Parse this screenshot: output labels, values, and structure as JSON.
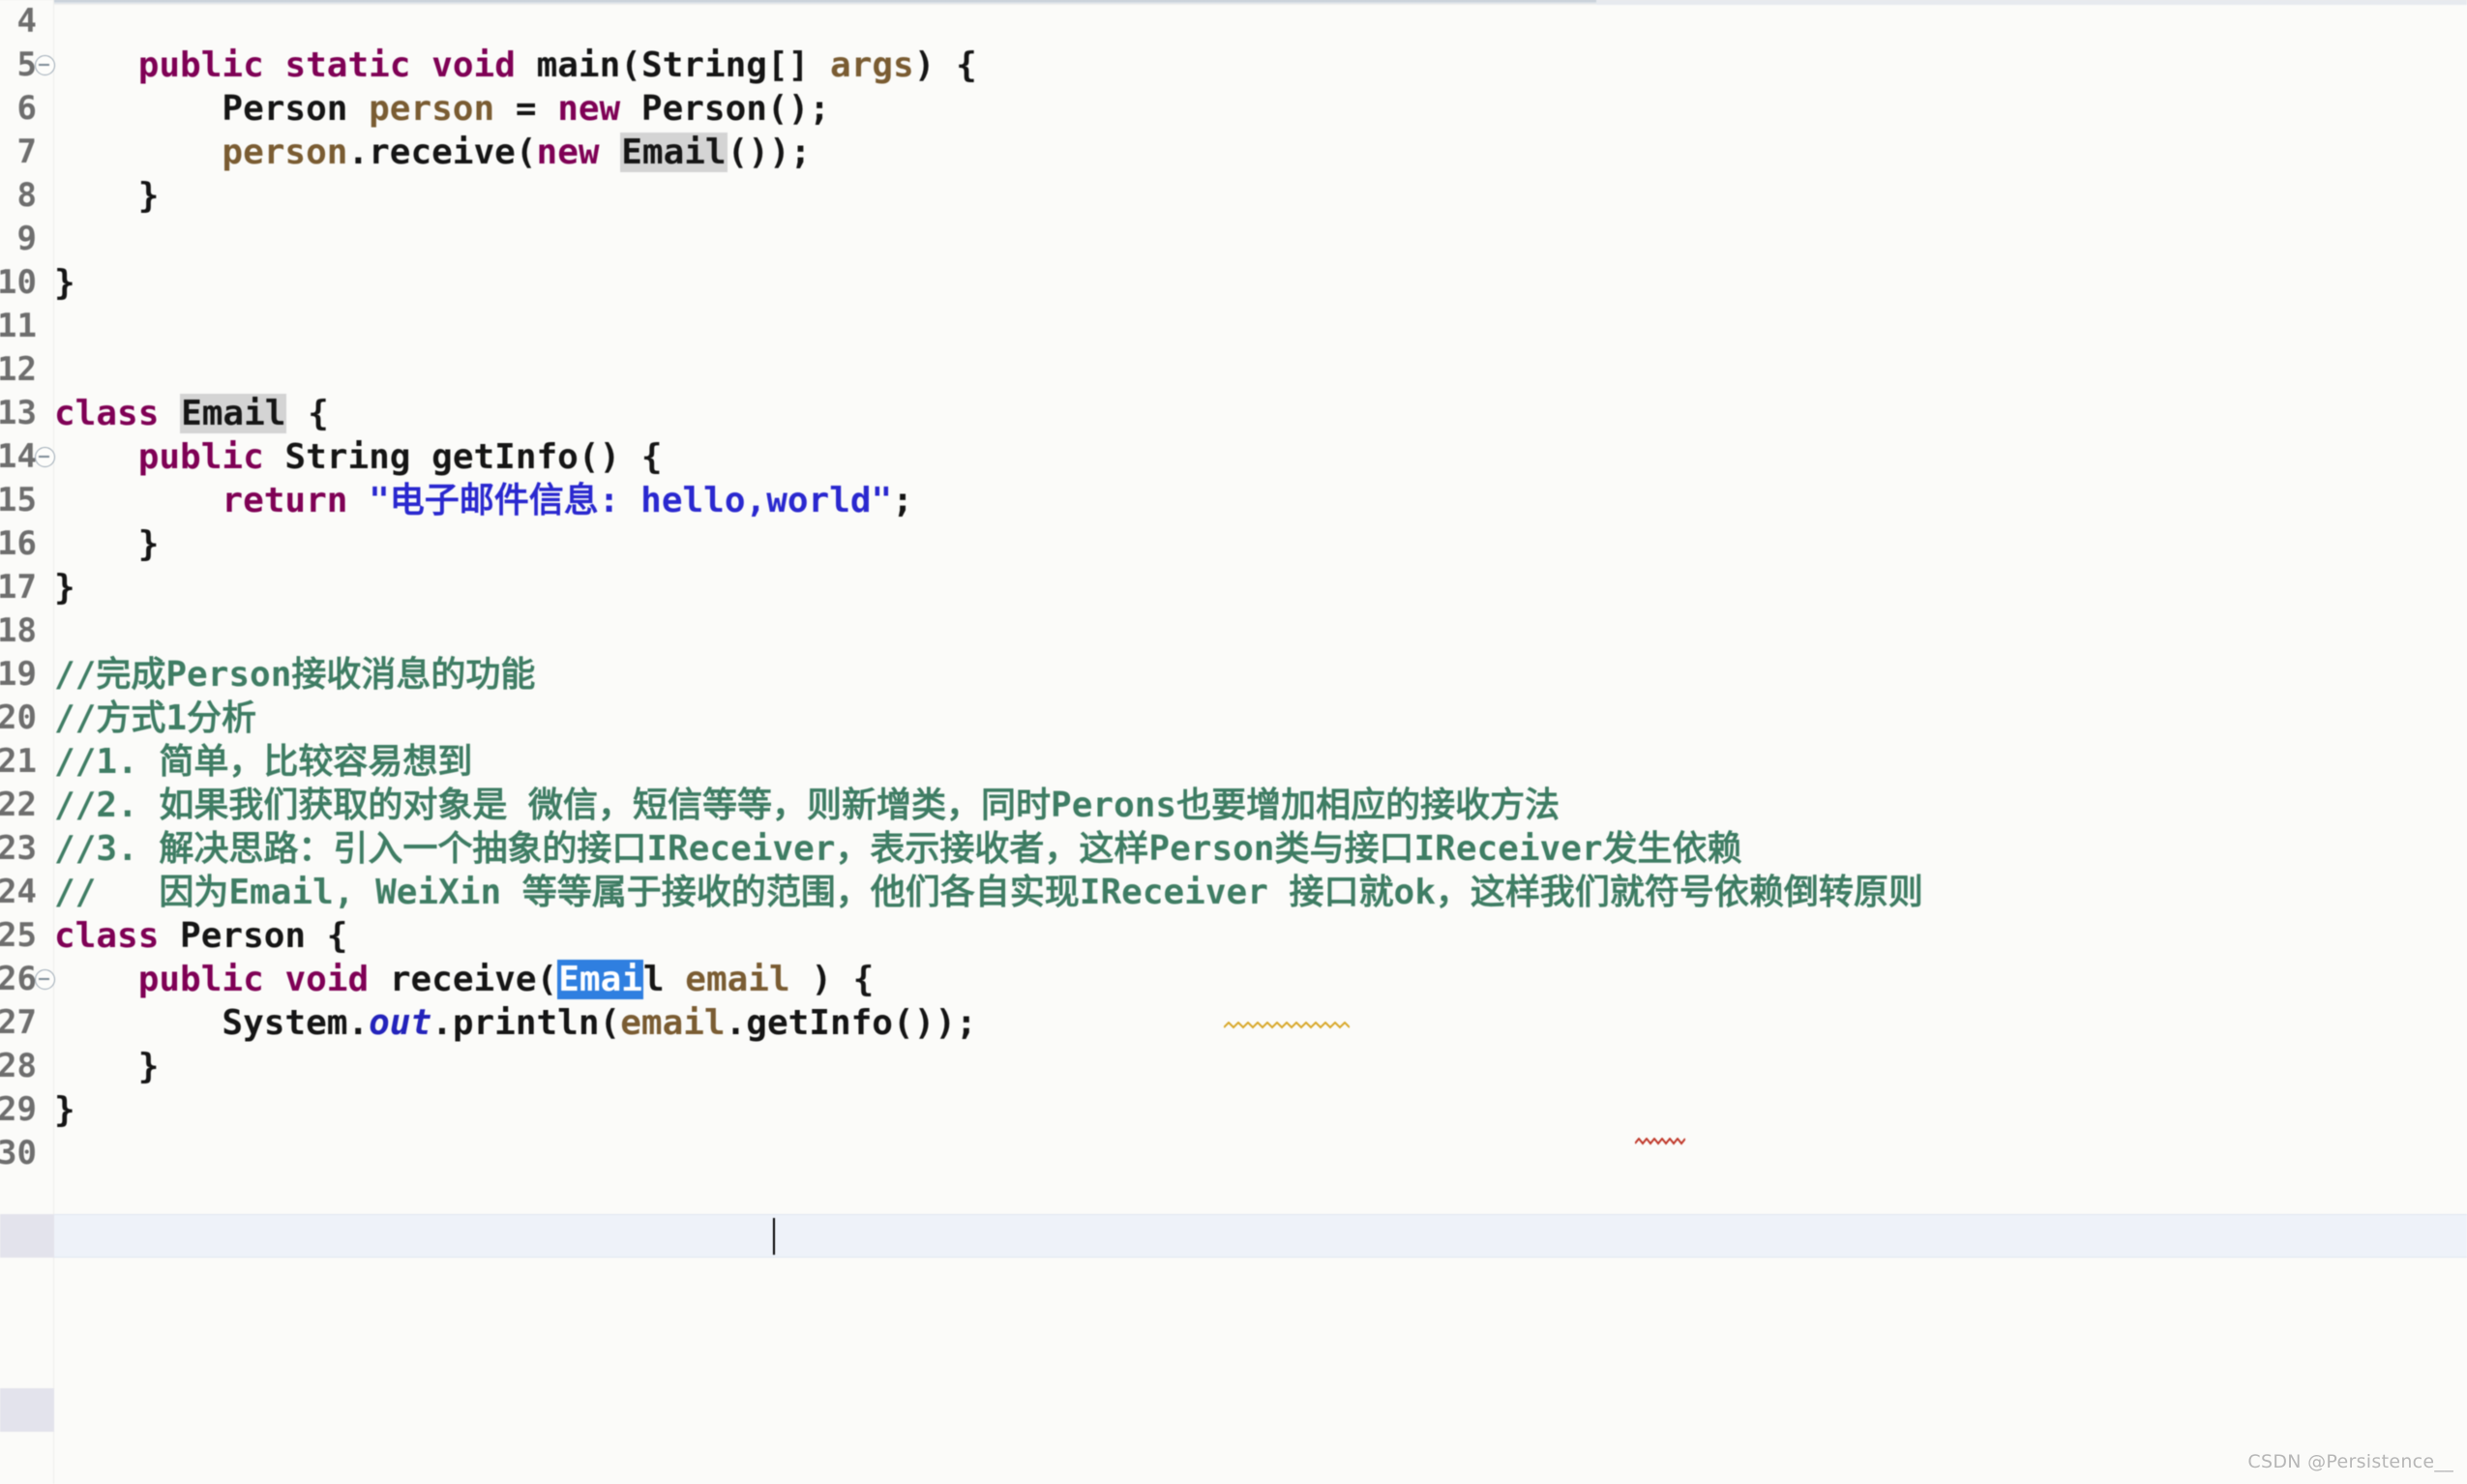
{
  "editor": {
    "language": "java",
    "watermark": "CSDN @Persistence__",
    "colors": {
      "background": "#fbfbf9",
      "keyword": "#7f0055",
      "string": "#2a28cf",
      "comment": "#3f7d64",
      "plain": "#151515",
      "local_variable": "#7a5c32",
      "static_field": "#2323bb",
      "occurrence_highlight": "#d4d4d4",
      "selection": "#2f7fe0",
      "current_line": "#eef2f9",
      "line_number": "#6e6e6e"
    },
    "selection_text": "Emai",
    "current_line_number": "26"
  },
  "lines": [
    {
      "number": "4",
      "fold": false,
      "current": false,
      "tokens": [
        {
          "t": "",
          "c": "plain"
        }
      ]
    },
    {
      "number": "5",
      "fold": true,
      "current": false,
      "tokens": [
        {
          "t": "    ",
          "c": "plain"
        },
        {
          "t": "public",
          "c": "kw"
        },
        {
          "t": " ",
          "c": "plain"
        },
        {
          "t": "static",
          "c": "kw"
        },
        {
          "t": " ",
          "c": "plain"
        },
        {
          "t": "void",
          "c": "kw"
        },
        {
          "t": " ",
          "c": "plain"
        },
        {
          "t": "main",
          "c": "plain"
        },
        {
          "t": "(String[] ",
          "c": "plain"
        },
        {
          "t": "args",
          "c": "fld"
        },
        {
          "t": ") {",
          "c": "plain"
        }
      ]
    },
    {
      "number": "6",
      "fold": false,
      "current": false,
      "tokens": [
        {
          "t": "        Person ",
          "c": "plain"
        },
        {
          "t": "person",
          "c": "fld"
        },
        {
          "t": " = ",
          "c": "plain"
        },
        {
          "t": "new",
          "c": "kw"
        },
        {
          "t": " Person();",
          "c": "plain"
        }
      ]
    },
    {
      "number": "7",
      "fold": false,
      "current": false,
      "tokens": [
        {
          "t": "        ",
          "c": "plain"
        },
        {
          "t": "person",
          "c": "fld"
        },
        {
          "t": ".receive(",
          "c": "plain"
        },
        {
          "t": "new",
          "c": "kw"
        },
        {
          "t": " ",
          "c": "plain"
        },
        {
          "t": "Email",
          "c": "plain occ"
        },
        {
          "t": "());",
          "c": "plain"
        }
      ]
    },
    {
      "number": "8",
      "fold": false,
      "current": false,
      "tokens": [
        {
          "t": "    }",
          "c": "plain"
        }
      ]
    },
    {
      "number": "9",
      "fold": false,
      "current": false,
      "tokens": [
        {
          "t": "",
          "c": "plain"
        }
      ]
    },
    {
      "number": "10",
      "fold": false,
      "current": false,
      "tokens": [
        {
          "t": "}",
          "c": "plain"
        }
      ]
    },
    {
      "number": "11",
      "fold": false,
      "current": false,
      "tokens": [
        {
          "t": "",
          "c": "plain"
        }
      ]
    },
    {
      "number": "12",
      "fold": false,
      "current": false,
      "tokens": [
        {
          "t": "",
          "c": "plain"
        }
      ]
    },
    {
      "number": "13",
      "fold": false,
      "current": false,
      "tokens": [
        {
          "t": "class",
          "c": "kw"
        },
        {
          "t": " ",
          "c": "plain"
        },
        {
          "t": "Email",
          "c": "plain occ"
        },
        {
          "t": " {",
          "c": "plain"
        }
      ]
    },
    {
      "number": "14",
      "fold": true,
      "current": false,
      "tokens": [
        {
          "t": "    ",
          "c": "plain"
        },
        {
          "t": "public",
          "c": "kw"
        },
        {
          "t": " String getInfo() {",
          "c": "plain"
        }
      ]
    },
    {
      "number": "15",
      "fold": false,
      "current": false,
      "tokens": [
        {
          "t": "        ",
          "c": "plain"
        },
        {
          "t": "return",
          "c": "kw"
        },
        {
          "t": " ",
          "c": "plain"
        },
        {
          "t": "\"电子邮件信息: hello,world\"",
          "c": "str"
        },
        {
          "t": ";",
          "c": "plain"
        }
      ]
    },
    {
      "number": "16",
      "fold": false,
      "current": false,
      "tokens": [
        {
          "t": "    }",
          "c": "plain"
        }
      ]
    },
    {
      "number": "17",
      "fold": false,
      "current": false,
      "tokens": [
        {
          "t": "}",
          "c": "plain"
        }
      ]
    },
    {
      "number": "18",
      "fold": false,
      "current": false,
      "tokens": [
        {
          "t": "",
          "c": "plain"
        }
      ]
    },
    {
      "number": "19",
      "fold": false,
      "current": false,
      "tokens": [
        {
          "t": "//完成Person接收消息的功能",
          "c": "cmt"
        }
      ]
    },
    {
      "number": "20",
      "fold": false,
      "current": false,
      "tokens": [
        {
          "t": "//方式1分析",
          "c": "cmt"
        }
      ]
    },
    {
      "number": "21",
      "fold": false,
      "current": false,
      "tokens": [
        {
          "t": "//1. 简单，比较容易想到",
          "c": "cmt"
        }
      ]
    },
    {
      "number": "22",
      "fold": false,
      "current": false,
      "tokens": [
        {
          "t": "//2. 如果我们获取的对象是 微信，短信等等，则新增类，同时Perons也要增加相应的接收方法",
          "c": "cmt"
        }
      ]
    },
    {
      "number": "23",
      "fold": false,
      "current": false,
      "tokens": [
        {
          "t": "//3. 解决思路：引入一个抽象的接口IReceiver，表示接收者，这样Person类与接口IReceiver发生依赖",
          "c": "cmt"
        }
      ]
    },
    {
      "number": "24",
      "fold": false,
      "current": false,
      "tokens": [
        {
          "t": "//   因为Email, WeiXin 等等属于接收的范围，他们各自实现IReceiver 接口就ok，这样我们就符号依赖倒转原则",
          "c": "cmt"
        }
      ]
    },
    {
      "number": "25",
      "fold": false,
      "current": false,
      "tokens": [
        {
          "t": "class",
          "c": "kw"
        },
        {
          "t": " Person {",
          "c": "plain"
        }
      ]
    },
    {
      "number": "26",
      "fold": true,
      "current": true,
      "tokens": [
        {
          "t": "    ",
          "c": "plain"
        },
        {
          "t": "public",
          "c": "kw"
        },
        {
          "t": " ",
          "c": "plain"
        },
        {
          "t": "void",
          "c": "kw"
        },
        {
          "t": " receive(",
          "c": "plain"
        },
        {
          "t": "Emai",
          "c": "sel"
        },
        {
          "t": "l ",
          "c": "plain"
        },
        {
          "t": "email",
          "c": "fld"
        },
        {
          "t": " ) {",
          "c": "plain"
        }
      ]
    },
    {
      "number": "27",
      "fold": false,
      "current": false,
      "tokens": [
        {
          "t": "        System.",
          "c": "plain"
        },
        {
          "t": "out",
          "c": "stat"
        },
        {
          "t": ".println(",
          "c": "plain"
        },
        {
          "t": "email",
          "c": "fld"
        },
        {
          "t": ".getInfo());",
          "c": "plain"
        }
      ]
    },
    {
      "number": "28",
      "fold": false,
      "current": false,
      "tokens": [
        {
          "t": "    }",
          "c": "plain"
        }
      ]
    },
    {
      "number": "29",
      "fold": false,
      "current": false,
      "tokens": [
        {
          "t": "}",
          "c": "plain"
        }
      ]
    },
    {
      "number": "30",
      "fold": false,
      "current": false,
      "tokens": [
        {
          "t": "",
          "c": "plain"
        }
      ]
    }
  ],
  "spell_warnings": [
    {
      "word": "Perons",
      "color": "#d8a82b",
      "line": "22"
    },
    {
      "word": "ok",
      "color": "#c0392b",
      "line": "24"
    }
  ]
}
